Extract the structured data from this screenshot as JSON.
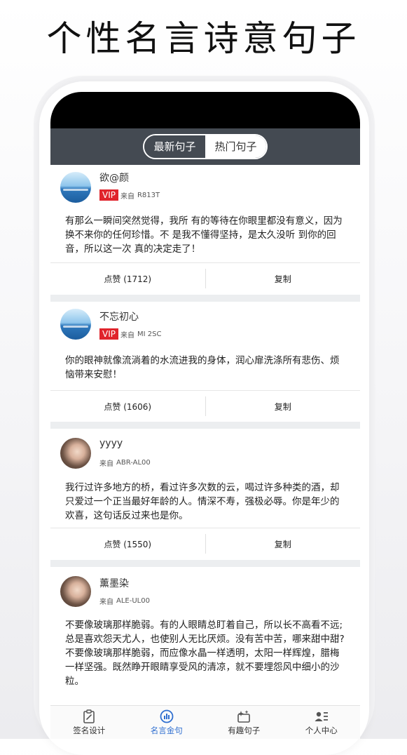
{
  "promo_title": "个性名言诗意句子",
  "header": {
    "tabs": [
      {
        "label": "最新句子",
        "active": true
      },
      {
        "label": "热门句子",
        "active": false
      }
    ]
  },
  "posts": [
    {
      "username": "欲@颜",
      "vip": "VIP",
      "from_prefix": "来自",
      "device": "R813T",
      "content": "有那么一瞬间突然觉得，我所 有的等待在你眼里都没有意义，因为换不来你的任何珍惜。不 是我不懂得坚持，是太久没听 到你的回音，所以这一次 真的决定走了！",
      "like_label": "点赞 (1712)",
      "copy_label": "复制"
    },
    {
      "username": "不忘初心",
      "vip": "VIP",
      "from_prefix": "来自",
      "device": "MI 2SC",
      "content": "你的眼神就像流淌着的水流进我的身体，润心扉洗涤所有悲伤、烦恼带来安慰！",
      "like_label": "点赞 (1606)",
      "copy_label": "复制"
    },
    {
      "username": "yyyy",
      "from_prefix": "来自",
      "device": "ABR-AL00",
      "content": "我行过许多地方的桥，看过许多次数的云，喝过许多种类的酒，却只爱过一个正当最好年龄的人。情深不寿，强极必辱。你是年少的欢喜，这句话反过来也是你。",
      "like_label": "点赞 (1550)",
      "copy_label": "复制"
    },
    {
      "username": "薰墨染",
      "from_prefix": "来自",
      "device": "ALE-UL00",
      "content": "不要像玻璃那样脆弱。有的人眼睛总盯着自己，所以长不高看不远;总是喜欢怨天尤人，也使别人无比厌烦。没有苦中苦，哪来甜中甜?不要像玻璃那样脆弱，而应像水晶一样透明，太阳一样辉煌，腊梅一样坚强。既然睁开眼睛享受风的清凉，就不要埋怨风中细小的沙粒。"
    }
  ],
  "tabbar": {
    "items": [
      {
        "label": "签名设计",
        "icon": "signature-design-icon",
        "active": false
      },
      {
        "label": "名言金句",
        "icon": "quotes-chart-icon",
        "active": true
      },
      {
        "label": "有趣句子",
        "icon": "fun-sparkle-icon",
        "active": false
      },
      {
        "label": "个人中心",
        "icon": "profile-icon",
        "active": false
      }
    ]
  },
  "colors": {
    "header_bg": "#444a52",
    "vip_red": "#e0242c",
    "active_tab": "#2f6fd0"
  }
}
